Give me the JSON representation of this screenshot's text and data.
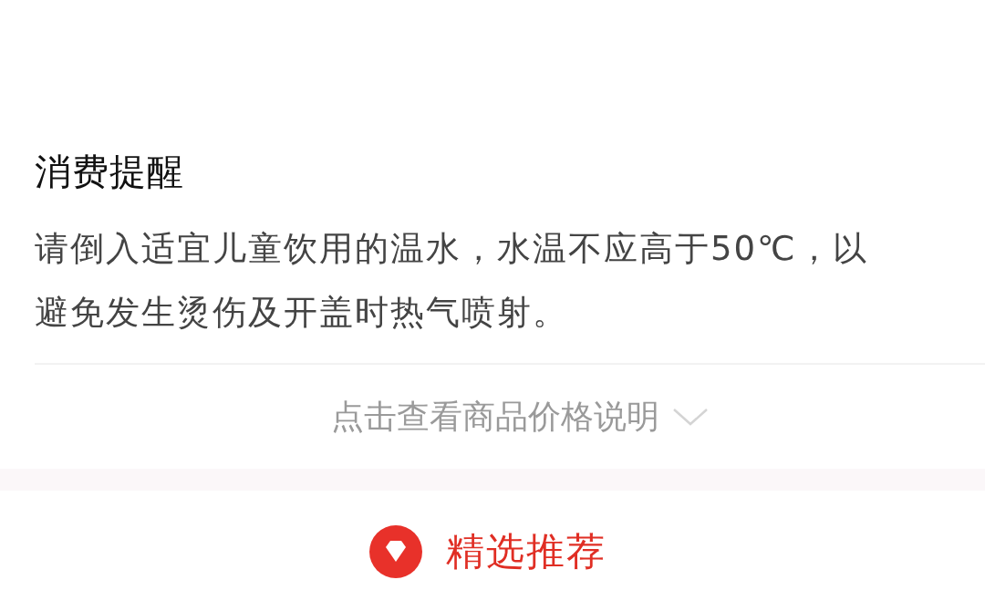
{
  "notice": {
    "title": "消费提醒",
    "text": "请倒入适宜儿童饮用的温水，水温不应高于50℃，以避免发生烫伤及开盖时热气喷射。"
  },
  "price_link": {
    "label": "点击查看商品价格说明",
    "expanded": false
  },
  "recommend": {
    "label": "精选推荐"
  }
}
